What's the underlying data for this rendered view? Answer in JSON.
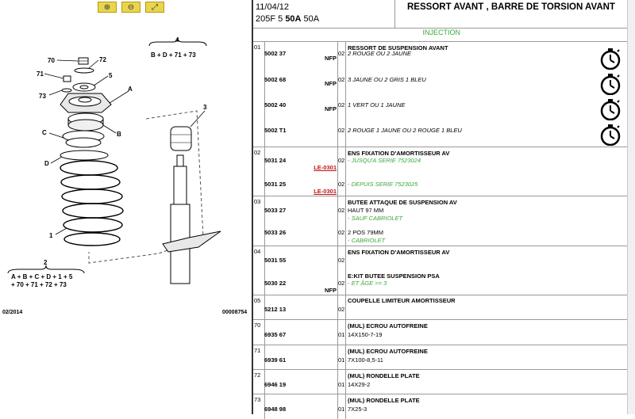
{
  "header": {
    "date": "11/04/12",
    "model_prefix": "205F 5 ",
    "model_bold": "50A",
    "model_suffix": " 50A",
    "title": "RESSORT AVANT , BARRE DE TORSION AVANT"
  },
  "subheader": "INJECTION",
  "zoom_buttons": [
    "zoom-in-icon",
    "zoom-out-icon",
    "zoom-fit-icon"
  ],
  "diagram": {
    "callouts": [
      "70",
      "72",
      "71",
      "5",
      "73",
      "A",
      "C",
      "B",
      "D",
      "1",
      "3",
      "4",
      "2"
    ],
    "formula_4": "B + D + 71 + 73",
    "formula_2a": "A + B + C + D + 1 + 5",
    "formula_2b": "+ 70 + 71 + 72 + 73",
    "footer_left": "02/2014",
    "footer_right": "00008754"
  },
  "colors": {
    "green": "#3aa83a",
    "red": "#c01515",
    "zoom": "#e9d44e"
  },
  "rows": [
    {
      "id": "01",
      "items": [
        {
          "num": "5002 37",
          "tag": "NFP",
          "tag_color": "black",
          "qty": "02",
          "name": "RESSORT DE SUSPENSION AVANT",
          "desc": "2 ROUGE OU 2 JAUNE",
          "desc_style": "ital",
          "timer": true
        },
        {
          "num": "5002 68",
          "tag": "NFP",
          "tag_color": "black",
          "qty": "02",
          "name": "",
          "desc": "3 JAUNE OU 2 GRIS 1 BLEU",
          "desc_style": "ital",
          "timer": true
        },
        {
          "num": "5002 40",
          "tag": "NFP",
          "tag_color": "black",
          "qty": "02",
          "name": "",
          "desc": "1 VERT OU 1 JAUNE",
          "desc_style": "ital",
          "timer": true
        },
        {
          "num": "5002 T1",
          "tag": "",
          "tag_color": "black",
          "qty": "02",
          "name": "",
          "desc": "2 ROUGE 1 JAUNE OU 2 ROUGE 1 BLEU",
          "desc_style": "ital",
          "timer": true
        }
      ]
    },
    {
      "id": "02",
      "items": [
        {
          "num": "5031 24",
          "tag": "LE-0301",
          "tag_color": "red",
          "qty": "02",
          "name": "ENS FIXATION D'AMORTISSEUR AV",
          "desc": "- JUSQU'A SERIE 7523024",
          "desc_style": "green"
        },
        {
          "num": "5031 25",
          "tag": "LE-0301",
          "tag_color": "red",
          "qty": "02",
          "name": "",
          "desc": "- DEPUIS SERIE 7523025",
          "desc_style": "green"
        }
      ]
    },
    {
      "id": "03",
      "items": [
        {
          "num": "5033 27",
          "tag": "",
          "qty": "02",
          "name": "BUTEE ATTAQUE DE SUSPENSION AV",
          "desc": "HAUT 97 MM",
          "desc2": "- SAUF CABRIOLET"
        },
        {
          "num": "5033 26",
          "tag": "",
          "qty": "02",
          "name": "",
          "desc": "2 POS 79MM",
          "desc2": "- CABRIOLET"
        }
      ]
    },
    {
      "id": "04",
      "items": [
        {
          "num": "5031 55",
          "tag": "",
          "qty": "02",
          "name": "ENS FIXATION D'AMORTISSEUR AV",
          "desc": ""
        },
        {
          "num": "5030 22",
          "tag": "NFP",
          "tag_color": "black",
          "qty": "02",
          "name": "E:KIT BUTEE SUSPENSION PSA",
          "desc": "- ET ÂGE >= 3",
          "desc_style": "green"
        }
      ]
    },
    {
      "id": "05",
      "items": [
        {
          "num": "5212 13",
          "tag": "",
          "qty": "02",
          "name": "COUPELLE LIMITEUR AMORTISSEUR",
          "desc": ""
        }
      ]
    },
    {
      "id": "70",
      "items": [
        {
          "num": "6935 67",
          "tag": "",
          "qty": "01",
          "name": "(MUL) ECROU AUTOFREINE",
          "desc": "14X150-7-19"
        }
      ]
    },
    {
      "id": "71",
      "items": [
        {
          "num": "6939 61",
          "tag": "",
          "qty": "01",
          "name": "(MUL) ECROU AUTOFREINE",
          "desc": "7X100-8,5-11"
        }
      ]
    },
    {
      "id": "72",
      "items": [
        {
          "num": "6946 19",
          "tag": "",
          "qty": "01",
          "name": "(MUL) RONDELLE PLATE",
          "desc": "14X29-2"
        }
      ]
    },
    {
      "id": "73",
      "items": [
        {
          "num": "6948 98",
          "tag": "",
          "qty": "01",
          "name": "(MUL) RONDELLE PLATE",
          "desc": "7X25-3"
        }
      ]
    }
  ]
}
